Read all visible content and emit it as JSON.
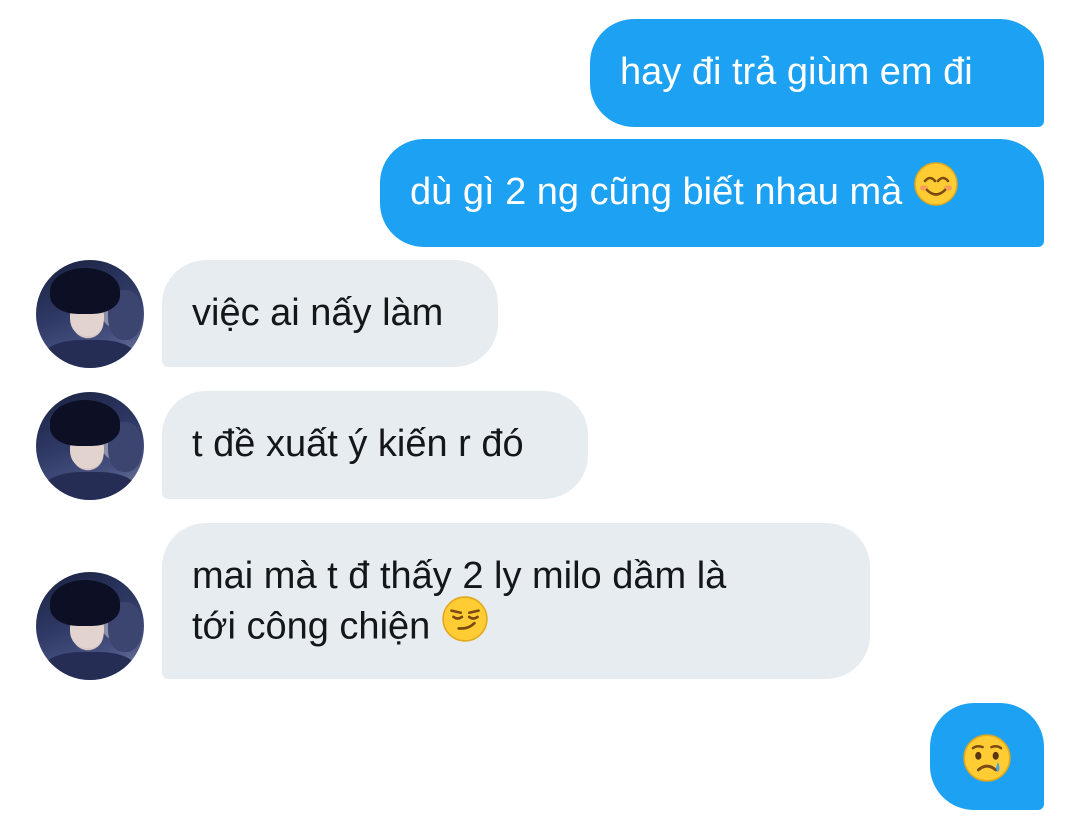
{
  "messages": [
    {
      "text": "hay đi trả giùm em đi"
    },
    {
      "text": "dù gì 2 ng cũng biết nhau mà ",
      "emoji": "smiling-face-icon"
    },
    {
      "text": "việc ai nấy làm"
    },
    {
      "text": "t đề xuất ý kiến r đó"
    },
    {
      "line1": "mai mà t đ thấy 2 ly milo dầm là",
      "line2": "tới công chiện ",
      "emoji": "smirking-face-icon"
    },
    {
      "emoji": "crying-face-icon"
    }
  ],
  "colors": {
    "outgoing_bubble": "#1da1f2",
    "incoming_bubble": "#e6ecf0",
    "incoming_text": "#14171a"
  }
}
